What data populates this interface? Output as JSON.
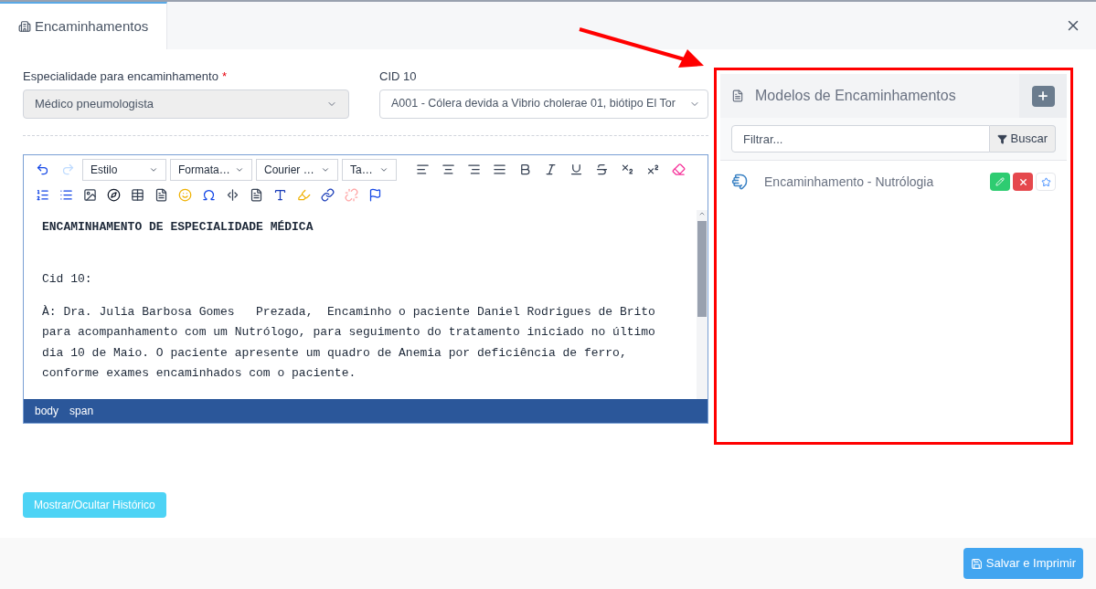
{
  "tab": {
    "label": "Encaminhamentos",
    "selected": true
  },
  "form": {
    "specialty": {
      "label": "Especialidade para encaminhamento",
      "required": true,
      "required_mark": "*",
      "value": "Médico pneumologista",
      "disabled": true
    },
    "cid": {
      "label": "CID 10",
      "value": "A001 - Cólera devida a Vibrio cholerae 01, biótipo El Tor"
    }
  },
  "editor": {
    "history": [
      {
        "kind": "undo",
        "disabled": false
      },
      {
        "kind": "redo",
        "disabled": true
      }
    ],
    "dropdowns": [
      "Estilo",
      "Formata…",
      "Courier …",
      "Ta…"
    ],
    "content": [
      {
        "kind": "heading",
        "text": "ENCAMINHAMENTO DE ESPECIALIDADE MÉDICA"
      },
      {
        "kind": "paragraph",
        "text": "Cid 10:"
      },
      {
        "kind": "paragraph",
        "text": "À: Dra. Julia Barbosa Gomes   Prezada,  Encaminho o paciente Daniel Rodrigues de Brito para acompanhamento com um Nutrólogo, para seguimento do tratamento iniciado no último dia 10 de Maio. O paciente apresente um quadro de Anemia por deficiência de ferro, conforme exames encaminhados com o paciente."
      }
    ],
    "path": [
      "body",
      "span"
    ]
  },
  "models_panel": {
    "title": "Modelos de Encaminhamentos",
    "filter_placeholder": "Filtrar...",
    "search_button": "Buscar",
    "items": [
      {
        "label": "Encaminhamento - Nutrólogia",
        "favorite": false
      }
    ]
  },
  "history_button": "Mostrar/Ocultar Histórico",
  "save_button": "Salvar e Imprimir"
}
